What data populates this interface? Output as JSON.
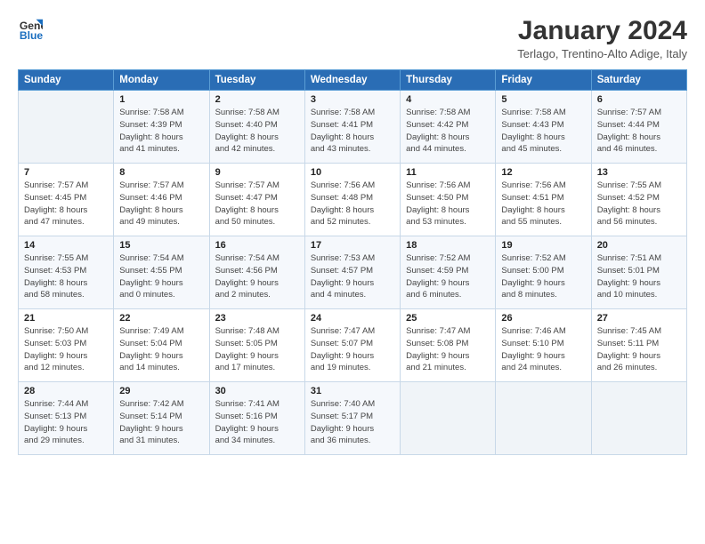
{
  "logo": {
    "line1": "General",
    "line2": "Blue"
  },
  "title": "January 2024",
  "location": "Terlago, Trentino-Alto Adige, Italy",
  "headers": [
    "Sunday",
    "Monday",
    "Tuesday",
    "Wednesday",
    "Thursday",
    "Friday",
    "Saturday"
  ],
  "weeks": [
    [
      {
        "day": "",
        "info": ""
      },
      {
        "day": "1",
        "info": "Sunrise: 7:58 AM\nSunset: 4:39 PM\nDaylight: 8 hours\nand 41 minutes."
      },
      {
        "day": "2",
        "info": "Sunrise: 7:58 AM\nSunset: 4:40 PM\nDaylight: 8 hours\nand 42 minutes."
      },
      {
        "day": "3",
        "info": "Sunrise: 7:58 AM\nSunset: 4:41 PM\nDaylight: 8 hours\nand 43 minutes."
      },
      {
        "day": "4",
        "info": "Sunrise: 7:58 AM\nSunset: 4:42 PM\nDaylight: 8 hours\nand 44 minutes."
      },
      {
        "day": "5",
        "info": "Sunrise: 7:58 AM\nSunset: 4:43 PM\nDaylight: 8 hours\nand 45 minutes."
      },
      {
        "day": "6",
        "info": "Sunrise: 7:57 AM\nSunset: 4:44 PM\nDaylight: 8 hours\nand 46 minutes."
      }
    ],
    [
      {
        "day": "7",
        "info": "Sunrise: 7:57 AM\nSunset: 4:45 PM\nDaylight: 8 hours\nand 47 minutes."
      },
      {
        "day": "8",
        "info": "Sunrise: 7:57 AM\nSunset: 4:46 PM\nDaylight: 8 hours\nand 49 minutes."
      },
      {
        "day": "9",
        "info": "Sunrise: 7:57 AM\nSunset: 4:47 PM\nDaylight: 8 hours\nand 50 minutes."
      },
      {
        "day": "10",
        "info": "Sunrise: 7:56 AM\nSunset: 4:48 PM\nDaylight: 8 hours\nand 52 minutes."
      },
      {
        "day": "11",
        "info": "Sunrise: 7:56 AM\nSunset: 4:50 PM\nDaylight: 8 hours\nand 53 minutes."
      },
      {
        "day": "12",
        "info": "Sunrise: 7:56 AM\nSunset: 4:51 PM\nDaylight: 8 hours\nand 55 minutes."
      },
      {
        "day": "13",
        "info": "Sunrise: 7:55 AM\nSunset: 4:52 PM\nDaylight: 8 hours\nand 56 minutes."
      }
    ],
    [
      {
        "day": "14",
        "info": "Sunrise: 7:55 AM\nSunset: 4:53 PM\nDaylight: 8 hours\nand 58 minutes."
      },
      {
        "day": "15",
        "info": "Sunrise: 7:54 AM\nSunset: 4:55 PM\nDaylight: 9 hours\nand 0 minutes."
      },
      {
        "day": "16",
        "info": "Sunrise: 7:54 AM\nSunset: 4:56 PM\nDaylight: 9 hours\nand 2 minutes."
      },
      {
        "day": "17",
        "info": "Sunrise: 7:53 AM\nSunset: 4:57 PM\nDaylight: 9 hours\nand 4 minutes."
      },
      {
        "day": "18",
        "info": "Sunrise: 7:52 AM\nSunset: 4:59 PM\nDaylight: 9 hours\nand 6 minutes."
      },
      {
        "day": "19",
        "info": "Sunrise: 7:52 AM\nSunset: 5:00 PM\nDaylight: 9 hours\nand 8 minutes."
      },
      {
        "day": "20",
        "info": "Sunrise: 7:51 AM\nSunset: 5:01 PM\nDaylight: 9 hours\nand 10 minutes."
      }
    ],
    [
      {
        "day": "21",
        "info": "Sunrise: 7:50 AM\nSunset: 5:03 PM\nDaylight: 9 hours\nand 12 minutes."
      },
      {
        "day": "22",
        "info": "Sunrise: 7:49 AM\nSunset: 5:04 PM\nDaylight: 9 hours\nand 14 minutes."
      },
      {
        "day": "23",
        "info": "Sunrise: 7:48 AM\nSunset: 5:05 PM\nDaylight: 9 hours\nand 17 minutes."
      },
      {
        "day": "24",
        "info": "Sunrise: 7:47 AM\nSunset: 5:07 PM\nDaylight: 9 hours\nand 19 minutes."
      },
      {
        "day": "25",
        "info": "Sunrise: 7:47 AM\nSunset: 5:08 PM\nDaylight: 9 hours\nand 21 minutes."
      },
      {
        "day": "26",
        "info": "Sunrise: 7:46 AM\nSunset: 5:10 PM\nDaylight: 9 hours\nand 24 minutes."
      },
      {
        "day": "27",
        "info": "Sunrise: 7:45 AM\nSunset: 5:11 PM\nDaylight: 9 hours\nand 26 minutes."
      }
    ],
    [
      {
        "day": "28",
        "info": "Sunrise: 7:44 AM\nSunset: 5:13 PM\nDaylight: 9 hours\nand 29 minutes."
      },
      {
        "day": "29",
        "info": "Sunrise: 7:42 AM\nSunset: 5:14 PM\nDaylight: 9 hours\nand 31 minutes."
      },
      {
        "day": "30",
        "info": "Sunrise: 7:41 AM\nSunset: 5:16 PM\nDaylight: 9 hours\nand 34 minutes."
      },
      {
        "day": "31",
        "info": "Sunrise: 7:40 AM\nSunset: 5:17 PM\nDaylight: 9 hours\nand 36 minutes."
      },
      {
        "day": "",
        "info": ""
      },
      {
        "day": "",
        "info": ""
      },
      {
        "day": "",
        "info": ""
      }
    ]
  ]
}
